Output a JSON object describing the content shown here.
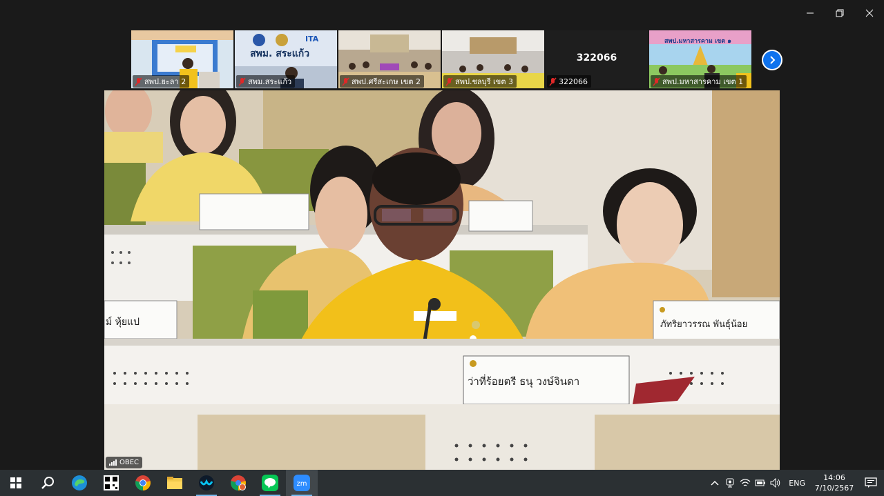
{
  "window": {
    "controls": [
      "minimize",
      "restore",
      "close"
    ]
  },
  "thumbnails": [
    {
      "label": "สพป.ยะลา 2",
      "muted": true
    },
    {
      "label": "สพม.สระแก้ว",
      "muted": true,
      "sign_text": "สพม. สระแก้ว",
      "logo_text": "ITA"
    },
    {
      "label": "สพป.ศรีสะเกษ เขต 2",
      "muted": true
    },
    {
      "label": "สพป.ชลบุรี เขต 3",
      "muted": true
    },
    {
      "label": "322066",
      "muted": true,
      "center_text": "322066"
    },
    {
      "label": "สพป.มหาสารคาม เขต 1",
      "muted": true,
      "banner_text": "สพป.มหาสารคาม เขต ๑"
    }
  ],
  "main_video": {
    "participant_name": "OBEC",
    "nameplates": {
      "speaker": "ว่าที่ร้อยตรี ธนุ วงษ์จินดา",
      "right": "ภัทริยาวรรณ พันธุ์น้อย",
      "left_partial": "ม์ หุ้ยแป"
    }
  },
  "taskbar": {
    "apps": [
      "start",
      "search",
      "edge",
      "qr-app",
      "chrome",
      "file-explorer",
      "webex",
      "chrome-profile",
      "line",
      "zoom"
    ],
    "language": "ENG",
    "time": "14:06",
    "date": "7/10/2567"
  },
  "colors": {
    "accent": "#0e72ed",
    "mute_red": "#e02828",
    "taskbar": "#2b3033"
  }
}
